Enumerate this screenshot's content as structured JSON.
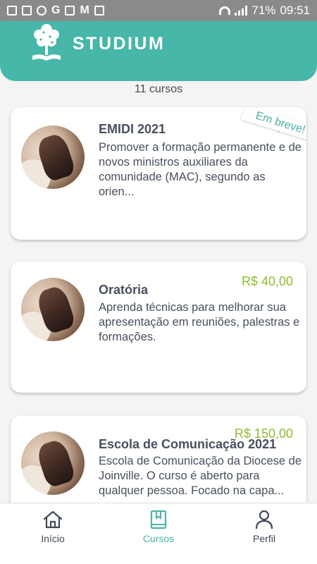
{
  "status_bar": {
    "battery": "71%",
    "time": "09:51",
    "icons": [
      "android-icon",
      "image-icon",
      "person-icon",
      "google-icon",
      "mail-icon",
      "gmail-icon",
      "camera-icon",
      "wifi-icon",
      "signal-icon"
    ]
  },
  "header": {
    "brand": "STUDIUM",
    "logo_icon": "tree-book-icon",
    "color": "#46b7a9"
  },
  "course_count": "11 cursos",
  "courses": [
    {
      "title": "EMIDI 2021",
      "description": "Promover a formação permanente e de novos ministros auxiliares da comunidade (MAC), segundo as orien...",
      "price": "R$",
      "ribbon": "Em breve!"
    },
    {
      "title": "Oratória",
      "description": "Aprenda técnicas para melhorar sua apresentação em reuniões, palestras e formações.",
      "price": "R$ 40,00"
    },
    {
      "title": "Escola de Comunicação 2021",
      "description": "Escola de Comunicação da Diocese de Joinville. O curso é aberto para qualquer pessoa. Focado na capa...",
      "price": "R$ 150,00"
    }
  ],
  "nav": [
    {
      "label": "Início",
      "icon": "home-icon",
      "active": false
    },
    {
      "label": "Cursos",
      "icon": "book-icon",
      "active": true
    },
    {
      "label": "Perfil",
      "icon": "user-icon",
      "active": false
    }
  ],
  "colors": {
    "accent": "#46b7a9",
    "price": "#8cbf2a",
    "text": "#46505f"
  }
}
